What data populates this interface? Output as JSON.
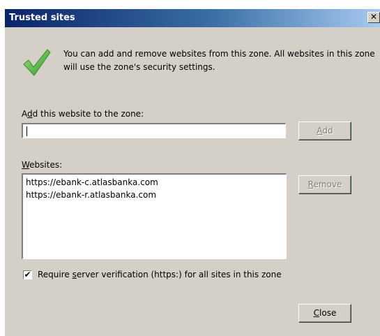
{
  "window": {
    "title": "Trusted sites",
    "close_glyph": "✕"
  },
  "info": {
    "text": "You can add and remove websites from this zone. All websites in this zone will use the zone's security settings."
  },
  "add_section": {
    "label_pre": "A",
    "label_mnemonic": "d",
    "label_post": "d this website to the zone:",
    "input_value": "",
    "add_mnemonic": "A",
    "add_rest": "dd"
  },
  "websites_section": {
    "label_mnemonic": "W",
    "label_rest": "ebsites:",
    "items": [
      "https://ebank-c.atlasbanka.com",
      "https://ebank-r.atlasbanka.com"
    ],
    "remove_mnemonic": "R",
    "remove_rest": "emove"
  },
  "require_verification": {
    "checked": true,
    "check_glyph": "✔",
    "label_pre": "Require ",
    "label_mnemonic": "s",
    "label_post": "erver verification (https:) for all sites in this zone"
  },
  "footer": {
    "close_mnemonic": "C",
    "close_rest": "lose"
  },
  "icons": {
    "check": "green-checkmark-icon"
  }
}
